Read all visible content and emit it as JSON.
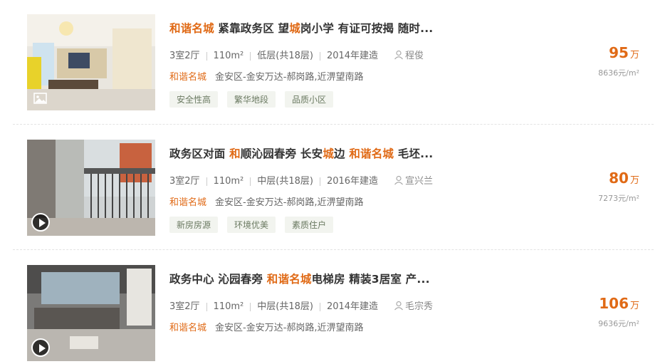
{
  "listings": [
    {
      "title_parts": [
        {
          "text": "和谐名城",
          "hl": true
        },
        {
          "text": " 紧靠政务区 望",
          "hl": false
        },
        {
          "text": "城",
          "hl": true
        },
        {
          "text": "岗小学 有证可按揭 随时...",
          "hl": false
        }
      ],
      "layout": "3室2厅",
      "area": "110m²",
      "floor": "低层(共18层)",
      "built": "2014年建造",
      "agent": "程俊",
      "community": "和谐名城",
      "address": "金安区-金安万达-郝岗路,近淠望南路",
      "tags": [
        "安全性高",
        "繁华地段",
        "品质小区"
      ],
      "price": "95",
      "price_unit": "万",
      "unit_price": "8636元/m²",
      "media": "photo-icon"
    },
    {
      "title_parts": [
        {
          "text": "政务区对面 ",
          "hl": false
        },
        {
          "text": "和",
          "hl": true
        },
        {
          "text": "顺沁园春旁 长安",
          "hl": false
        },
        {
          "text": "城",
          "hl": true
        },
        {
          "text": "边 ",
          "hl": false
        },
        {
          "text": "和谐名城",
          "hl": true
        },
        {
          "text": " 毛坯...",
          "hl": false
        }
      ],
      "layout": "3室2厅",
      "area": "110m²",
      "floor": "中层(共18层)",
      "built": "2016年建造",
      "agent": "宣兴兰",
      "community": "和谐名城",
      "address": "金安区-金安万达-郝岗路,近淠望南路",
      "tags": [
        "新房房源",
        "环境优美",
        "素质住户"
      ],
      "price": "80",
      "price_unit": "万",
      "unit_price": "7273元/m²",
      "media": "play-icon"
    },
    {
      "title_parts": [
        {
          "text": "政务中心 沁园春旁 ",
          "hl": false
        },
        {
          "text": "和谐名城",
          "hl": true
        },
        {
          "text": "电梯房 精装3居室 产...",
          "hl": false
        }
      ],
      "layout": "3室2厅",
      "area": "110m²",
      "floor": "中层(共18层)",
      "built": "2014年建造",
      "agent": "毛宗秀",
      "community": "和谐名城",
      "address": "金安区-金安万达-郝岗路,近淠望南路",
      "tags": [],
      "price": "106",
      "price_unit": "万",
      "unit_price": "9636元/m²",
      "media": "play-icon"
    }
  ]
}
